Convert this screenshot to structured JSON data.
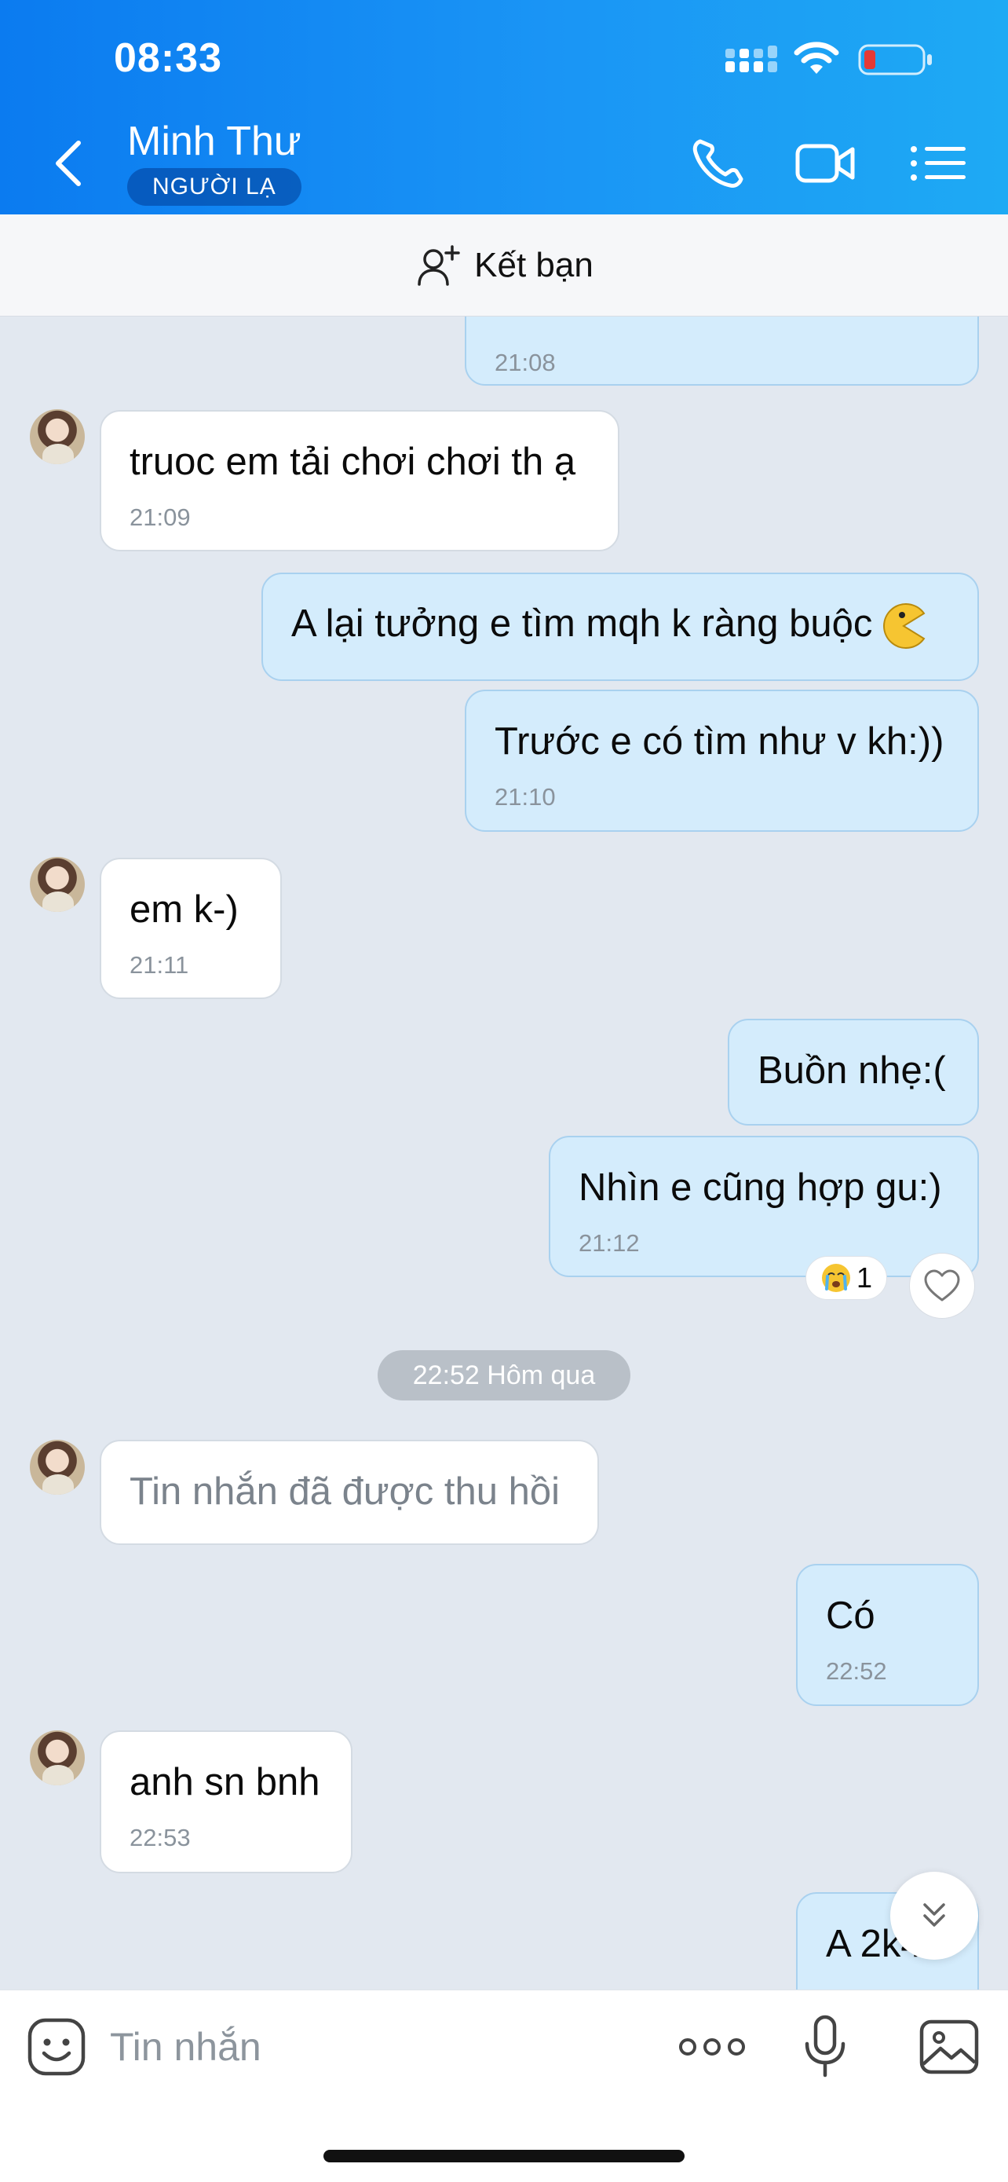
{
  "status_bar": {
    "time": "08:33"
  },
  "header": {
    "contact_name": "Minh Thư",
    "badge": "NGƯỜI LẠ"
  },
  "add_friend": {
    "label": "Kết bạn"
  },
  "messages": [
    {
      "dir": "out",
      "text": "",
      "time": "21:08"
    },
    {
      "dir": "in",
      "text": "truoc em tải chơi chơi th ạ",
      "time": "21:09"
    },
    {
      "dir": "out",
      "text": "A lại tưởng e tìm mqh k ràng buộc",
      "time": ""
    },
    {
      "dir": "out",
      "text": "Trước e có tìm như v kh:))",
      "time": "21:10"
    },
    {
      "dir": "in",
      "text": "em k-)",
      "time": "21:11"
    },
    {
      "dir": "out",
      "text": "Buồn nhẹ:(",
      "time": ""
    },
    {
      "dir": "out",
      "text": "Nhìn e cũng hợp gu:)",
      "time": "21:12"
    },
    {
      "dir": "in",
      "text": "Tin nhắn đã được thu hồi",
      "time": ""
    },
    {
      "dir": "out",
      "text": "Có",
      "time": "22:52"
    },
    {
      "dir": "in",
      "text": "anh sn bnh",
      "time": "22:53"
    },
    {
      "dir": "out",
      "text": "A 2k4",
      "time": ""
    }
  ],
  "reaction": {
    "count": "1"
  },
  "date_separator": "22:52 Hôm qua",
  "input": {
    "placeholder": "Tin nhắn",
    "value": ""
  },
  "icons": {
    "back": "chevron-left-icon",
    "call": "phone-icon",
    "video": "video-camera-icon",
    "menu": "list-menu-icon",
    "add_friend": "add-user-icon",
    "sticker": "sticker-smile-icon",
    "more": "more-dots-icon",
    "mic": "microphone-icon",
    "image": "image-icon",
    "scroll_down": "double-chevron-down-icon"
  },
  "colors": {
    "header_start": "#0b7bf0",
    "header_end": "#1eaaf4",
    "bubble_out": "#d4ecfc",
    "bubble_in": "#ffffff",
    "chat_bg": "#e2e8f0",
    "battery_low": "#e53935"
  }
}
